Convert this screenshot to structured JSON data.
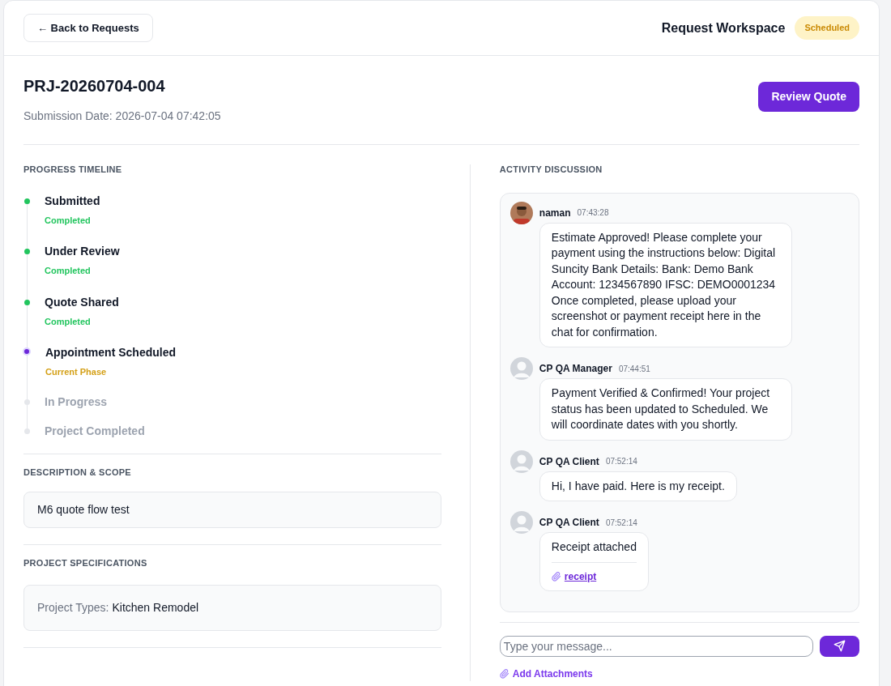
{
  "header": {
    "back_button": "← Back to Requests",
    "title": "Request Workspace",
    "status_badge": "Scheduled"
  },
  "request": {
    "id": "PRJ-20260704-004",
    "submission_date": "Submission Date: 2026-07-04 07:42:05",
    "action_button": "Review Quote"
  },
  "timeline": {
    "heading": "PROGRESS TIMELINE",
    "steps": [
      {
        "label": "Submitted",
        "kind": "completed",
        "status_text": "Completed"
      },
      {
        "label": "Under Review",
        "kind": "completed",
        "status_text": "Completed"
      },
      {
        "label": "Quote Shared",
        "kind": "completed",
        "status_text": "Completed"
      },
      {
        "label": "Appointment Scheduled",
        "kind": "current",
        "status_text": "Current Phase"
      },
      {
        "label": "In Progress",
        "kind": "pending"
      },
      {
        "label": "Project Completed",
        "kind": "pending"
      }
    ]
  },
  "description": {
    "heading": "DESCRIPTION & SCOPE",
    "text": "M6 quote flow test"
  },
  "specifications": {
    "heading": "PROJECT SPECIFICATIONS",
    "label": "Project Types:",
    "value": "Kitchen Remodel"
  },
  "discussion": {
    "heading": "ACTIVITY DISCUSSION",
    "messages": [
      {
        "author": "naman",
        "time": "07:43:28",
        "text": "Estimate Approved! Please complete your payment using the instructions below: Digital Suncity Bank Details: Bank: Demo Bank Account: 1234567890 IFSC: DEMO0001234 Once completed, please upload your screenshot or payment receipt here in the chat for confirmation."
      },
      {
        "author": "CP QA Manager",
        "time": "07:44:51",
        "avatar": {
          "kind": "placeholder"
        },
        "text": "Payment Verified & Confirmed! Your project status has been updated to Scheduled. We will coordinate dates with you shortly."
      },
      {
        "author": "CP QA Client",
        "time": "07:52:14",
        "avatar": {
          "kind": "placeholder"
        },
        "text": "Hi, I have paid. Here is my receipt."
      },
      {
        "author": "CP QA Client",
        "time": "07:52:14",
        "avatar": {
          "kind": "placeholder"
        },
        "text": "Receipt attached",
        "attachment": "receipt"
      }
    ],
    "input": {
      "placeholder": "Type your message..."
    },
    "add_attachments": "Add Attachments"
  }
}
